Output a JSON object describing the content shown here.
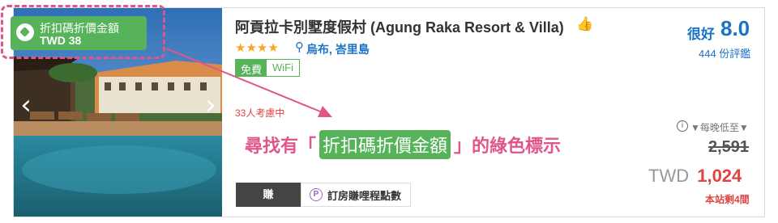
{
  "hotel": {
    "title": "阿貢拉卡別墅度假村 (Agung Raka Resort & Villa)",
    "stars": "★★★★",
    "location": "烏布, 峇里島",
    "amenity_tag_a": "免費",
    "amenity_tag_b": "WiFi",
    "viewing": "33人考慮中"
  },
  "discount_badge": {
    "line1": "折扣碼折價金額",
    "line2": "TWD 38"
  },
  "hint": {
    "before": "尋找有「",
    "highlight": "折扣碼折價金額",
    "after": "」的綠色標示"
  },
  "actions": {
    "earn": "賺",
    "points": "訂房賺哩程點數"
  },
  "rating": {
    "word": "很好",
    "score": "8.0",
    "reviews": "444 份評鑑"
  },
  "pricing": {
    "nightly_label": "▼每晚低至▼",
    "original": "2,591",
    "currency": "TWD",
    "amount": "1,024",
    "rooms_left": "本站剩4間"
  },
  "colors": {
    "accent_green": "#56b35a",
    "link_blue": "#1a73c7",
    "sale_red": "#e0433f",
    "annotation_pink": "#e0558a"
  }
}
